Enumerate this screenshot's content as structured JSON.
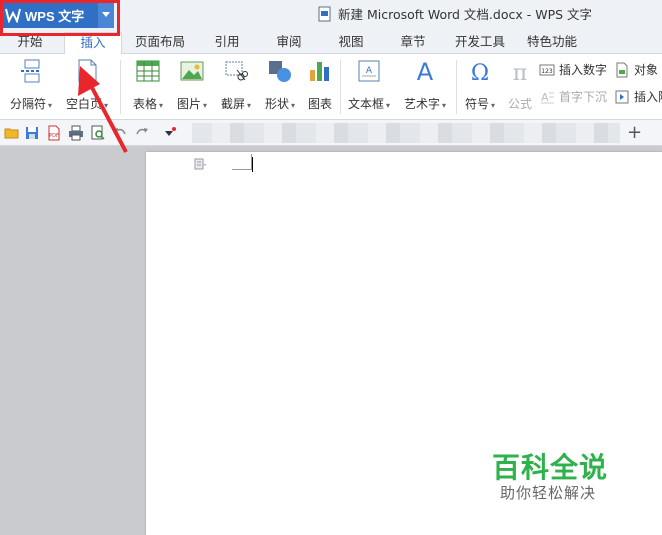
{
  "app": {
    "name": "WPS 文字",
    "window_title": "新建 Microsoft Word 文档.docx - WPS 文字"
  },
  "tabs": [
    {
      "label": "开始"
    },
    {
      "label": "插入"
    },
    {
      "label": "页面布局"
    },
    {
      "label": "引用"
    },
    {
      "label": "审阅"
    },
    {
      "label": "视图"
    },
    {
      "label": "章节"
    },
    {
      "label": "开发工具"
    },
    {
      "label": "特色功能"
    }
  ],
  "active_tab": "插入",
  "ribbon": {
    "buttons": [
      {
        "label": "分隔符",
        "icon": "page-break-icon"
      },
      {
        "label": "空白页",
        "icon": "blank-page-icon"
      },
      {
        "label": "表格",
        "icon": "table-icon"
      },
      {
        "label": "图片",
        "icon": "picture-icon"
      },
      {
        "label": "截屏",
        "icon": "screenshot-icon"
      },
      {
        "label": "形状",
        "icon": "shapes-icon"
      },
      {
        "label": "图表",
        "icon": "chart-icon"
      },
      {
        "label": "文本框",
        "icon": "textbox-icon"
      },
      {
        "label": "艺术字",
        "icon": "wordart-icon"
      },
      {
        "label": "符号",
        "icon": "omega-icon"
      },
      {
        "label": "公式",
        "icon": "pi-icon"
      }
    ],
    "small_buttons": [
      {
        "label": "插入数字",
        "icon": "insert-number-icon"
      },
      {
        "label": "对象",
        "icon": "object-icon"
      },
      {
        "label": "首字下沉",
        "icon": "drop-cap-icon"
      },
      {
        "label": "插入附",
        "icon": "attachment-icon"
      }
    ]
  },
  "watermark": {
    "title": "百科全说",
    "subtitle": "助你轻松解决"
  },
  "colors": {
    "accent": "#2f6fc4",
    "highlight": "#e8262c",
    "watermark": "#2fb24b"
  }
}
